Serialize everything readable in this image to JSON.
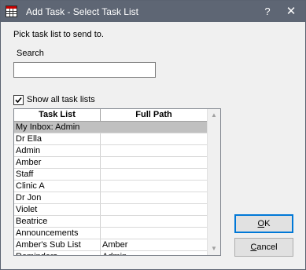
{
  "window": {
    "title": "Add Task - Select Task List",
    "help_label": "?",
    "close_label": "✕"
  },
  "form": {
    "instruction": "Pick task list to send to.",
    "search_label": "Search",
    "search_value": "",
    "show_all_label": "Show all task lists",
    "show_all_checked": true
  },
  "grid": {
    "columns": [
      "Task List",
      "Full Path"
    ],
    "rows": [
      {
        "task_list": "My Inbox: Admin",
        "full_path": "",
        "selected": true
      },
      {
        "task_list": "Dr Ella",
        "full_path": ""
      },
      {
        "task_list": "Admin",
        "full_path": ""
      },
      {
        "task_list": "Amber",
        "full_path": ""
      },
      {
        "task_list": "Staff",
        "full_path": ""
      },
      {
        "task_list": "Clinic A",
        "full_path": ""
      },
      {
        "task_list": "Dr Jon",
        "full_path": ""
      },
      {
        "task_list": "Violet",
        "full_path": ""
      },
      {
        "task_list": "Beatrice",
        "full_path": ""
      },
      {
        "task_list": "Announcements",
        "full_path": ""
      },
      {
        "task_list": "Amber's Sub List",
        "full_path": "Amber"
      },
      {
        "task_list": "Reminders",
        "full_path": "Admin"
      }
    ]
  },
  "buttons": {
    "ok_first": "O",
    "ok_rest": "K",
    "cancel_first": "C",
    "cancel_rest": "ancel"
  },
  "icons": {
    "app": "grid-window-icon",
    "checkbox": "checkmark-icon",
    "scroll_up": "arrow-up-icon",
    "scroll_down": "arrow-down-icon"
  }
}
